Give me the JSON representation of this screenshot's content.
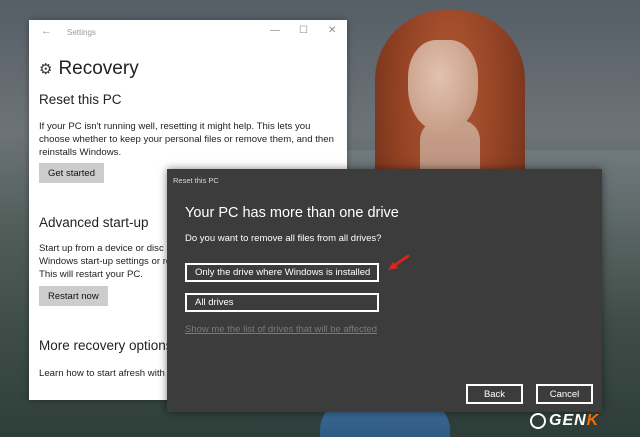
{
  "settings_window": {
    "title": "Settings",
    "back_icon": "back-arrow-icon",
    "minimize_glyph": "—",
    "maximize_glyph": "☐",
    "close_glyph": "✕",
    "page_title": "Recovery",
    "reset_section": {
      "heading": "Reset this PC",
      "description": "If your PC isn't running well, resetting it might help. This lets you choose whether to keep your personal files or remove them, and then reinstalls Windows.",
      "button": "Get started"
    },
    "advanced_section": {
      "heading": "Advanced start-up",
      "description": "Start up from a device or disc (such as a USB drive or DVD), change Windows start-up settings or restore Windows from a system image. This will restart your PC.",
      "button": "Restart now"
    },
    "more_section": {
      "heading": "More recovery options",
      "description": "Learn how to start afresh with a clean installation of Windows"
    }
  },
  "reset_dialog": {
    "title": "Reset this PC",
    "heading": "Your PC has more than one drive",
    "question": "Do you want to remove all files from all drives?",
    "option_windows_drive": "Only the drive where Windows is installed",
    "option_all_drives": "All drives",
    "drives_link": "Show me the list of drives that will be affected",
    "back_button": "Back",
    "cancel_button": "Cancel"
  },
  "watermark": {
    "text_main": "GEN",
    "text_accent": "K",
    "accent_color": "#ff6a00"
  },
  "colors": {
    "dialog_bg": "#3c3c3c",
    "arrow_red": "#e0231b"
  }
}
